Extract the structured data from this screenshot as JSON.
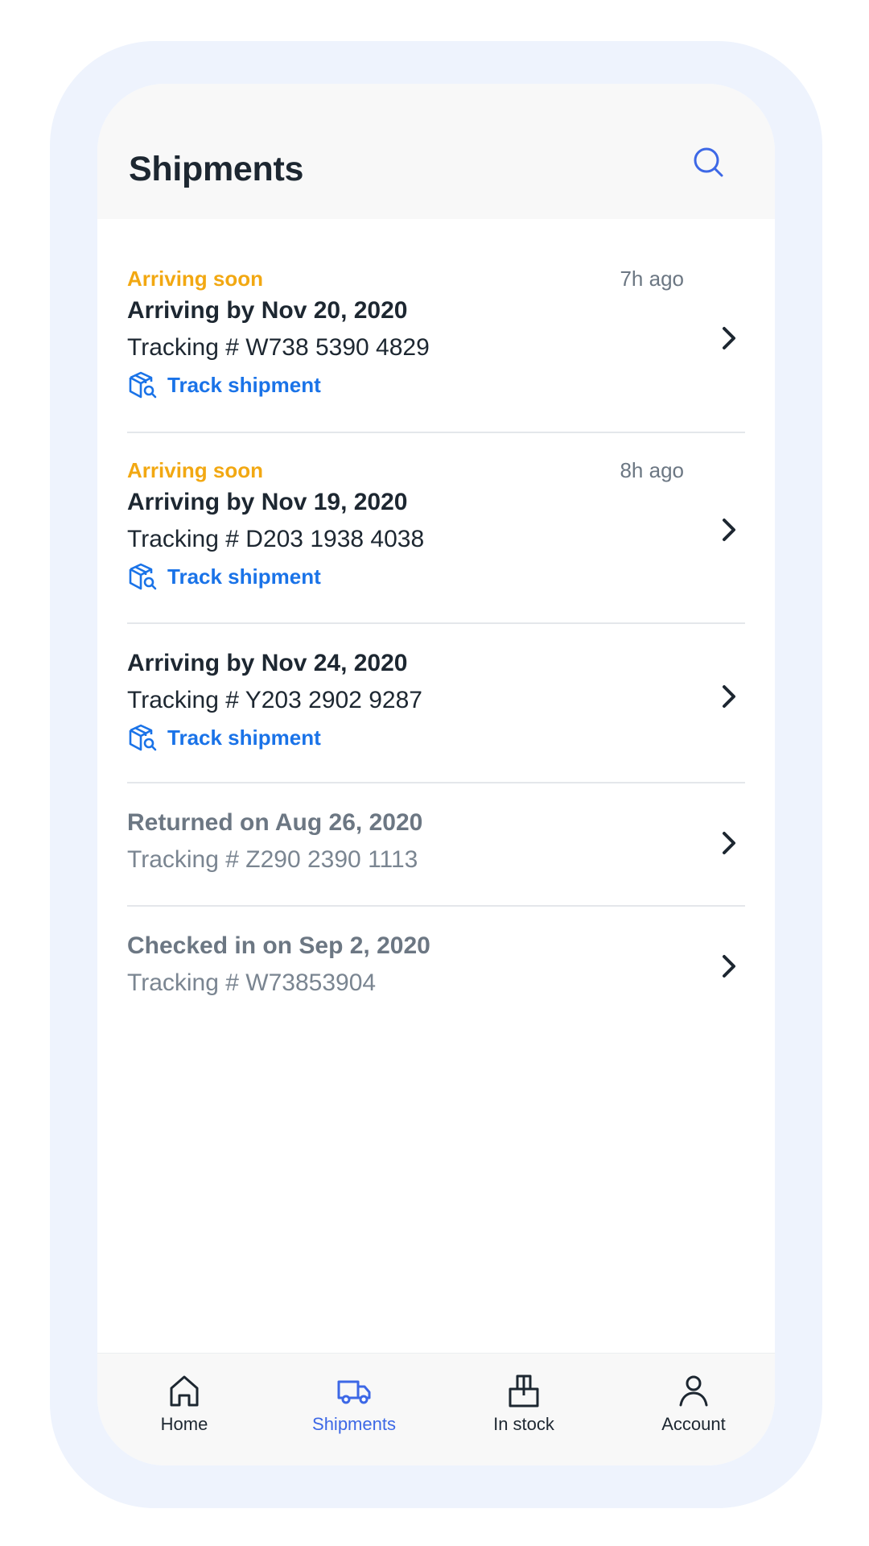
{
  "header": {
    "title": "Shipments",
    "search_icon": "search-icon"
  },
  "shipments": [
    {
      "status": "Arriving soon",
      "time": "7h ago",
      "date": "Arriving by Nov 20, 2020",
      "tracking": "Tracking # W738 5390 4829",
      "track_label": "Track shipment"
    },
    {
      "status": "Arriving soon",
      "time": "8h ago",
      "date": "Arriving by Nov 19, 2020",
      "tracking": "Tracking # D203 1938 4038",
      "track_label": "Track shipment"
    },
    {
      "date": "Arriving by Nov 24, 2020",
      "tracking": "Tracking # Y203 2902 9287",
      "track_label": "Track shipment"
    },
    {
      "date": "Returned on Aug 26, 2020",
      "tracking": "Tracking # Z290 2390 1113"
    },
    {
      "date": "Checked in on Sep 2, 2020",
      "tracking": "Tracking # W73853904"
    }
  ],
  "bottom_nav": {
    "items": [
      {
        "label": "Home",
        "icon": "home-icon"
      },
      {
        "label": "Shipments",
        "icon": "truck-icon",
        "active": true
      },
      {
        "label": "In stock",
        "icon": "box-icon"
      },
      {
        "label": "Account",
        "icon": "user-icon"
      }
    ]
  },
  "colors": {
    "frame": "#eef3fd",
    "status_orange": "#f2a812",
    "link_blue": "#1a73e8",
    "active_blue": "#3d68e6",
    "text_dark": "#1d2731",
    "text_muted": "#6c7783"
  }
}
